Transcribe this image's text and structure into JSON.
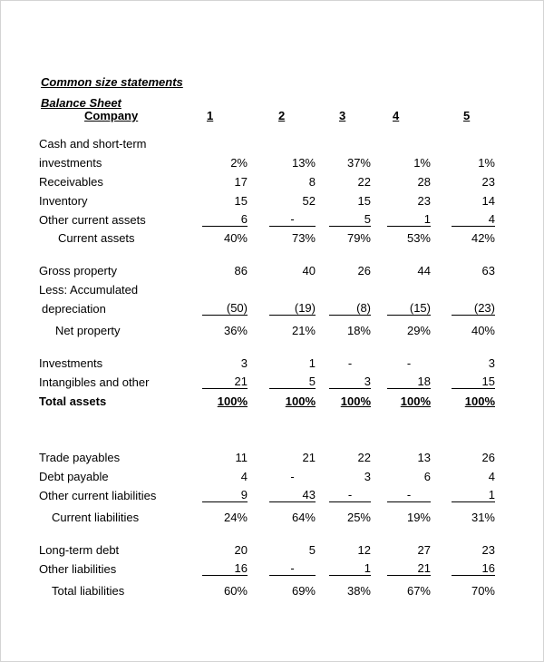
{
  "document": {
    "title": "Common size statements",
    "subtitle": "Balance Sheet",
    "header": {
      "label": "Company",
      "columns": [
        "1",
        "2",
        "3",
        "4",
        "5"
      ]
    },
    "rows": [
      {
        "label": "Cash and short-term",
        "values": [
          "",
          "",
          "",
          "",
          ""
        ]
      },
      {
        "label": "investments",
        "values": [
          "2%",
          "13%",
          "37%",
          "1%",
          "1%"
        ]
      },
      {
        "label": "Receivables",
        "values": [
          "17",
          "8",
          "22",
          "28",
          "23"
        ]
      },
      {
        "label": "Inventory",
        "values": [
          "15",
          "52",
          "15",
          "23",
          "14"
        ]
      },
      {
        "label": "Other current assets",
        "values": [
          "6",
          "-",
          "5",
          "1",
          "4"
        ]
      },
      {
        "label": "Current assets",
        "values": [
          "40%",
          "73%",
          "79%",
          "53%",
          "42%"
        ]
      },
      {
        "label": "Gross property",
        "values": [
          "86",
          "40",
          "26",
          "44",
          "63"
        ]
      },
      {
        "label": "Less: Accumulated",
        "values": [
          "",
          "",
          "",
          "",
          ""
        ]
      },
      {
        "label": "depreciation",
        "values": [
          "(50)",
          "(19)",
          "(8)",
          "(15)",
          "(23)"
        ]
      },
      {
        "label": "Net property",
        "values": [
          "36%",
          "21%",
          "18%",
          "29%",
          "40%"
        ]
      },
      {
        "label": "Investments",
        "values": [
          "3",
          "1",
          "-",
          "-",
          "3"
        ]
      },
      {
        "label": "Intangibles and other",
        "values": [
          "21",
          "5",
          "3",
          "18",
          "15"
        ]
      },
      {
        "label": "Total assets",
        "values": [
          "100%",
          "100%",
          "100%",
          "100%",
          "100%"
        ]
      },
      {
        "label": "Trade payables",
        "values": [
          "11",
          "21",
          "22",
          "13",
          "26"
        ]
      },
      {
        "label": "Debt payable",
        "values": [
          "4",
          "-",
          "3",
          "6",
          "4"
        ]
      },
      {
        "label": "Other current liabilities",
        "values": [
          "9",
          "43",
          "-",
          "-",
          "1"
        ]
      },
      {
        "label": "Current liabilities",
        "values": [
          "24%",
          "64%",
          "25%",
          "19%",
          "31%"
        ]
      },
      {
        "label": "Long-term debt",
        "values": [
          "20",
          "5",
          "12",
          "27",
          "23"
        ]
      },
      {
        "label": "Other liabilities",
        "values": [
          "16",
          "-",
          "1",
          "21",
          "16"
        ]
      },
      {
        "label": "Total liabilities",
        "values": [
          "60%",
          "69%",
          "38%",
          "67%",
          "70%"
        ]
      }
    ]
  }
}
